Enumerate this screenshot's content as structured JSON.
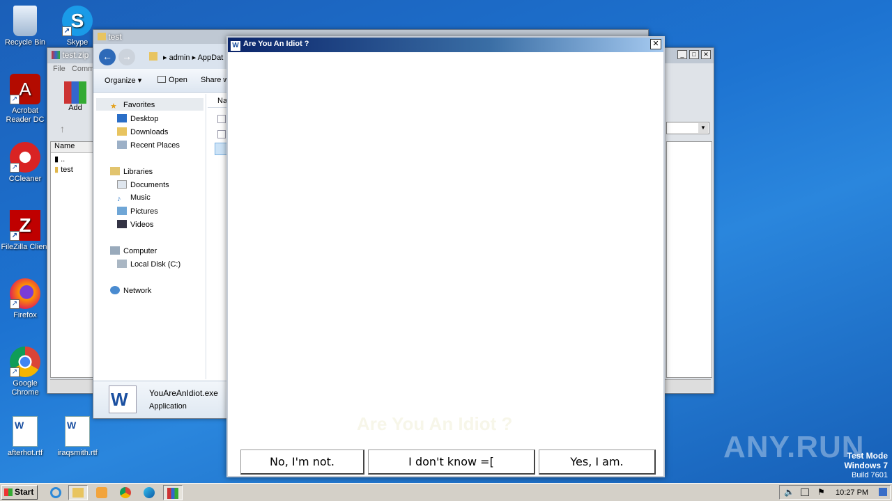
{
  "desktop": {
    "icons": [
      {
        "label": "Recycle Bin"
      },
      {
        "label": "Skype"
      },
      {
        "label": "Acrobat Reader DC"
      },
      {
        "label": "CCleaner"
      },
      {
        "label": "FileZilla Client"
      },
      {
        "label": "Firefox"
      },
      {
        "label": "Google Chrome"
      },
      {
        "label": "afterhot.rtf"
      },
      {
        "label": "iraqsmith.rtf"
      }
    ],
    "watermark": "ANY.RUN",
    "test_mode": {
      "line1": "Test Mode",
      "line2": "Windows 7",
      "line3": "Build 7601"
    }
  },
  "winrar": {
    "title": "test.zip",
    "menu": [
      "File",
      "Comm"
    ],
    "add_label": "Add",
    "column_name": "Name",
    "rows": [
      "..",
      "test"
    ]
  },
  "explorer": {
    "title": "test",
    "breadcrumb": [
      "admin",
      "AppDat"
    ],
    "toolbar": {
      "organize": "Organize",
      "open": "Open",
      "share": "Share w"
    },
    "column": "Na",
    "nav": {
      "favorites": "Favorites",
      "desktop": "Desktop",
      "downloads": "Downloads",
      "recent": "Recent Places",
      "libraries": "Libraries",
      "documents": "Documents",
      "music": "Music",
      "pictures": "Pictures",
      "videos": "Videos",
      "computer": "Computer",
      "local_disk": "Local Disk (C:)",
      "network": "Network"
    },
    "details": {
      "filename": "YouAreAnIdiot.exe",
      "type": "Application"
    }
  },
  "dialog": {
    "title": "Are You An Idiot ?",
    "faded_text": "Are You An Idiot ?",
    "buttons": {
      "no": "No, I'm not.",
      "dunno": "I don't know =[",
      "yes": "Yes, I am."
    }
  },
  "taskbar": {
    "start": "Start",
    "clock": "10:27 PM"
  },
  "colors": {
    "desktop": "#1d73d1",
    "dialog_title": "#0a246a"
  }
}
